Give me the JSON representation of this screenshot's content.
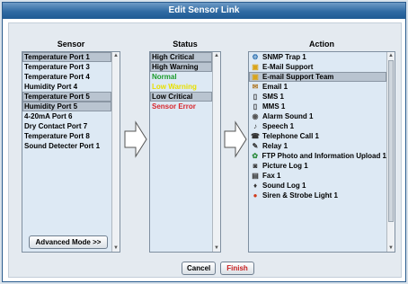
{
  "title": "Edit Sensor Link",
  "columns": {
    "sensor": "Sensor",
    "status": "Status",
    "action": "Action"
  },
  "sensors": [
    {
      "label": "Temperature Port 1",
      "selected": true
    },
    {
      "label": "Temperature Port 3",
      "selected": false
    },
    {
      "label": "Temperature Port 4",
      "selected": false
    },
    {
      "label": "Humidity Port 4",
      "selected": false
    },
    {
      "label": "Temperature Port 5",
      "selected": true
    },
    {
      "label": "Humidity Port 5",
      "selected": true
    },
    {
      "label": "4-20mA Port 6",
      "selected": false
    },
    {
      "label": "Dry Contact Port 7",
      "selected": false
    },
    {
      "label": "Temperature Port 8",
      "selected": false
    },
    {
      "label": "Sound Detecter Port 1",
      "selected": false
    }
  ],
  "statuses": [
    {
      "label": "High Critical",
      "selected": true,
      "color": "#000000"
    },
    {
      "label": "High Warning",
      "selected": true,
      "color": "#000000"
    },
    {
      "label": "Normal",
      "selected": false,
      "color": "#1a9a2a"
    },
    {
      "label": "Low Warning",
      "selected": false,
      "color": "#e8e000"
    },
    {
      "label": "Low Critical",
      "selected": true,
      "color": "#000000"
    },
    {
      "label": "Sensor Error",
      "selected": false,
      "color": "#d8262c"
    }
  ],
  "actions": [
    {
      "label": "SNMP Trap 1",
      "icon": "network-icon",
      "selected": false
    },
    {
      "label": "E-Mail Support",
      "icon": "folder-icon",
      "selected": false
    },
    {
      "label": "E-mail Support Team",
      "icon": "folder-icon",
      "selected": true
    },
    {
      "label": "Email 1",
      "icon": "envelope-icon",
      "selected": false
    },
    {
      "label": "SMS 1",
      "icon": "phone-screen-icon",
      "selected": false
    },
    {
      "label": "MMS 1",
      "icon": "phone-screen-icon",
      "selected": false
    },
    {
      "label": "Alarm Sound 1",
      "icon": "speaker-icon",
      "selected": false
    },
    {
      "label": "Speech 1",
      "icon": "speech-icon",
      "selected": false
    },
    {
      "label": "Telephone Call 1",
      "icon": "telephone-icon",
      "selected": false
    },
    {
      "label": "Relay 1",
      "icon": "relay-icon",
      "selected": false
    },
    {
      "label": "FTP Photo and Information Upload 1",
      "icon": "ftp-icon",
      "selected": false
    },
    {
      "label": "Picture Log 1",
      "icon": "camera-icon",
      "selected": false
    },
    {
      "label": "Fax 1",
      "icon": "fax-icon",
      "selected": false
    },
    {
      "label": "Sound Log 1",
      "icon": "microphone-icon",
      "selected": false
    },
    {
      "label": "Siren & Strobe Light 1",
      "icon": "siren-icon",
      "selected": false
    }
  ],
  "buttons": {
    "advanced": "Advanced Mode >>",
    "cancel": "Cancel",
    "finish": "Finish"
  },
  "colors": {
    "title_bar": "#2f6aa3",
    "finish_text": "#c81e1e",
    "list_bg": "#dde9f4"
  }
}
